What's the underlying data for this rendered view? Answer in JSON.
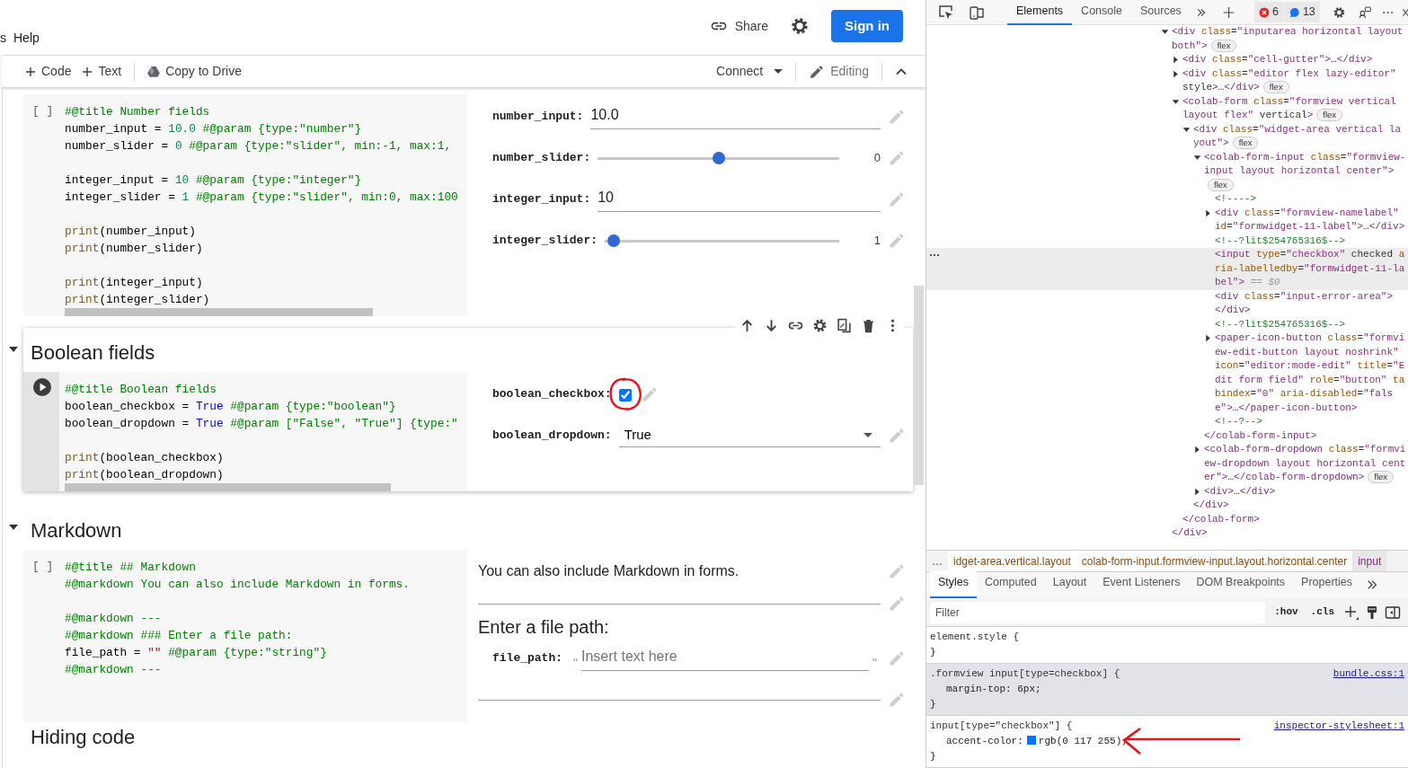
{
  "menu": {
    "items": [
      "s",
      "Help"
    ]
  },
  "header": {
    "share": "Share",
    "sign_in": "Sign in"
  },
  "toolbar": {
    "items": [
      {
        "kind": "add",
        "label": "Code"
      },
      {
        "kind": "add",
        "label": "Text"
      },
      {
        "kind": "drive",
        "label": "Copy to Drive"
      }
    ],
    "connect": "Connect",
    "mode": "Editing"
  },
  "notebook": [
    {
      "focused": false,
      "cell": {
        "gutter": "[ ]",
        "code": [
          {
            "parts": [
              {
                "kind": "comment",
                "text": "#@title Number fields"
              }
            ]
          },
          {
            "parts": [
              {
                "kind": "plain",
                "text": "number_input = "
              },
              {
                "kind": "number",
                "text": "10.0"
              },
              {
                "kind": "comment",
                "text": " #@param {type:\"number\"}"
              }
            ]
          },
          {
            "parts": [
              {
                "kind": "plain",
                "text": "number_slider = "
              },
              {
                "kind": "number",
                "text": "0"
              },
              {
                "kind": "comment",
                "text": " #@param {type:\"slider\", min:-1, max:1,"
              }
            ]
          },
          {
            "gap": true,
            "parts": [
              {
                "kind": "plain",
                "text": "integer_input = "
              },
              {
                "kind": "number",
                "text": "10"
              },
              {
                "kind": "comment",
                "text": " #@param {type:\"integer\"}"
              }
            ]
          },
          {
            "parts": [
              {
                "kind": "plain",
                "text": "integer_slider = "
              },
              {
                "kind": "number",
                "text": "1"
              },
              {
                "kind": "comment",
                "text": " #@param {type:\"slider\", min:0, max:100"
              }
            ]
          },
          {
            "gap": true,
            "parts": [
              {
                "kind": "builtin",
                "text": "print"
              },
              {
                "kind": "plain",
                "text": "(number_input)"
              }
            ]
          },
          {
            "parts": [
              {
                "kind": "builtin",
                "text": "print"
              },
              {
                "kind": "plain",
                "text": "(number_slider)"
              }
            ]
          },
          {
            "gap": true,
            "parts": [
              {
                "kind": "builtin",
                "text": "print"
              },
              {
                "kind": "plain",
                "text": "(integer_input)"
              }
            ]
          },
          {
            "parts": [
              {
                "kind": "builtin",
                "text": "print"
              },
              {
                "kind": "plain",
                "text": "(integer_slider)"
              }
            ]
          }
        ],
        "fields": [
          {
            "kind": "text",
            "label": "number_input:",
            "value": "10.0"
          },
          {
            "kind": "slider",
            "label": "number_slider:",
            "level": 0.5,
            "reading": "0"
          },
          {
            "kind": "text",
            "label": "integer_input:",
            "value": "10"
          },
          {
            "kind": "slider",
            "label": "integer_slider:",
            "level": 0.01,
            "reading": "1"
          }
        ]
      }
    },
    {
      "title": "Boolean fields",
      "expanded": true,
      "focused": true,
      "cell": {
        "code": [
          {
            "parts": [
              {
                "kind": "comment",
                "text": "#@title Boolean fields"
              }
            ]
          },
          {
            "parts": [
              {
                "kind": "plain",
                "text": "boolean_checkbox = "
              },
              {
                "kind": "keyword",
                "text": "True"
              },
              {
                "kind": "comment",
                "text": " #@param {type:\"boolean\"}"
              }
            ]
          },
          {
            "parts": [
              {
                "kind": "plain",
                "text": "boolean_dropdown = "
              },
              {
                "kind": "keyword",
                "text": "True"
              },
              {
                "kind": "comment",
                "text": " #@param [\"False\", \"True\"] {type:\""
              }
            ]
          },
          {
            "gap": true,
            "parts": [
              {
                "kind": "builtin",
                "text": "print"
              },
              {
                "kind": "plain",
                "text": "(boolean_checkbox)"
              }
            ]
          },
          {
            "parts": [
              {
                "kind": "builtin",
                "text": "print"
              },
              {
                "kind": "plain",
                "text": "(boolean_dropdown)"
              }
            ]
          }
        ],
        "fields": [
          {
            "kind": "checkbox",
            "label": "boolean_checkbox:",
            "checked": true,
            "circled": true
          },
          {
            "kind": "dropdown",
            "label": "boolean_dropdown:",
            "value": "True"
          }
        ]
      }
    },
    {
      "title": "Markdown",
      "expanded": true,
      "focused": false,
      "cell": {
        "gutter": "[ ]",
        "code": [
          {
            "parts": [
              {
                "kind": "comment",
                "text": "#@title ## Markdown"
              }
            ]
          },
          {
            "parts": [
              {
                "kind": "comment",
                "text": "#@markdown You can also include Markdown in forms."
              }
            ]
          },
          {
            "gap": true,
            "parts": [
              {
                "kind": "comment",
                "text": "#@markdown ---"
              }
            ]
          },
          {
            "parts": [
              {
                "kind": "comment",
                "text": "#@markdown ### Enter a file path:"
              }
            ]
          },
          {
            "parts": [
              {
                "kind": "plain",
                "text": "file_path = "
              },
              {
                "kind": "string",
                "text": "\"\""
              },
              {
                "kind": "comment",
                "text": " #@param {type:\"string\"}"
              }
            ]
          },
          {
            "parts": [
              {
                "kind": "comment",
                "text": "#@markdown ---"
              }
            ]
          }
        ],
        "fields": [
          {
            "kind": "markdown",
            "text": "You can also include Markdown in forms."
          },
          {
            "kind": "rule"
          },
          {
            "kind": "heading",
            "text": "Enter a file path:"
          },
          {
            "kind": "string",
            "label": "file_path:",
            "quote_open": "\"",
            "placeholder": "Insert text here",
            "quote_close": "\""
          },
          {
            "kind": "rule"
          }
        ]
      }
    },
    {
      "title": "Hiding code"
    }
  ],
  "devtools": {
    "tabs": [
      {
        "label": "Elements",
        "selected": true
      },
      {
        "label": "Console",
        "selected": false
      },
      {
        "label": "Sources",
        "selected": false
      }
    ],
    "errors": "6",
    "messages": "13",
    "tree": [
      {
        "text": "<div class=\"inputarea horizontal layout both\">",
        "expanded": true,
        "selected": false,
        "badge": "flex",
        "close": "</div>",
        "children": [
          {
            "text": "<div class=\"cell-gutter\">…</div>",
            "expanded": false,
            "selected": false
          },
          {
            "text": "<div class=\"editor flex lazy-editor\" style>…</div>",
            "expanded": false,
            "selected": false,
            "badge": "flex"
          },
          {
            "text": "<colab-form class=\"formview vertical layout flex\" vertical>",
            "expanded": true,
            "selected": false,
            "badge": "flex",
            "close": "</colab-form>",
            "children": [
              {
                "text": "<div class=\"widget-area vertical layout\">",
                "expanded": true,
                "selected": false,
                "badge": "flex",
                "close": "</div>",
                "children": [
                  {
                    "text": "<colab-form-input class=\"formview-input layout horizontal center\">",
                    "expanded": true,
                    "selected": false,
                    "badge": "flex",
                    "close": "</colab-form-input>",
                    "children": [
                      {
                        "text": "<!---->",
                        "selected": false
                      },
                      {
                        "text": "<div class=\"formview-namelabel\" id=\"formwidget-11-label\">…</div>",
                        "expanded": false,
                        "selected": false
                      },
                      {
                        "text": "<!--?lit$254765316$-->",
                        "selected": false
                      },
                      {
                        "text": "<input type=\"checkbox\" checked aria-labelledby=\"formwidget-11-label\">",
                        "suffix": "== $0",
                        "selected": true
                      },
                      {
                        "text": "<div class=\"input-error-area\">",
                        "selected": false,
                        "close": "</div>"
                      },
                      {
                        "text": "<!--?lit$254765316$-->",
                        "selected": false
                      },
                      {
                        "text": "<paper-icon-button class=\"formview-edit-button layout noshrink\" icon=\"editor:mode-edit\" title=\"Edit form field\" role=\"button\" tabindex=\"0\" aria-disabled=\"false\">…</paper-icon-button>",
                        "expanded": false,
                        "selected": false
                      },
                      {
                        "text": "<!--?-->",
                        "selected": false
                      }
                    ]
                  },
                  {
                    "text": "<colab-form-dropdown class=\"formview-dropdown layout horizontal center\">…</colab-form-dropdown>",
                    "expanded": false,
                    "selected": false,
                    "badge": "flex"
                  },
                  {
                    "text": "<div>…</div>",
                    "expanded": false,
                    "selected": false
                  }
                ]
              }
            ]
          }
        ]
      }
    ],
    "breadcrumbs": [
      {
        "label": "…",
        "selected": false
      },
      {
        "label": "idget-area.vertical.layout",
        "selected": false
      },
      {
        "label": "colab-form-input.formview-input.layout.horizontal.center",
        "selected": false
      },
      {
        "label": "input",
        "selected": true
      }
    ],
    "styles": {
      "tabs": [
        {
          "label": "Styles",
          "selected": true
        },
        {
          "label": "Computed",
          "selected": false
        },
        {
          "label": "Layout",
          "selected": false
        },
        {
          "label": "Event Listeners",
          "selected": false
        },
        {
          "label": "DOM Breakpoints",
          "selected": false
        },
        {
          "label": "Properties",
          "selected": false
        }
      ],
      "filter_placeholder": "Filter",
      "toggles": [
        ":hov",
        ".cls"
      ],
      "rules": [
        {
          "selector": "element.style {",
          "close": "}",
          "highlighted": false
        },
        {
          "selector": ".formview input[type=checkbox] {",
          "source": "bundle.css:1",
          "close": "}",
          "highlighted": true,
          "props": [
            {
              "name": "margin-top:",
              "value": "6px;"
            }
          ]
        },
        {
          "selector": "input[type=\"checkbox\"] {",
          "source": "inspector-stylesheet:1",
          "close": "}",
          "highlighted": false,
          "props": [
            {
              "name": "accent-color:",
              "value": "rgb(0 117 255);",
              "color": "#0075ff",
              "arrow": true
            }
          ]
        }
      ]
    }
  }
}
